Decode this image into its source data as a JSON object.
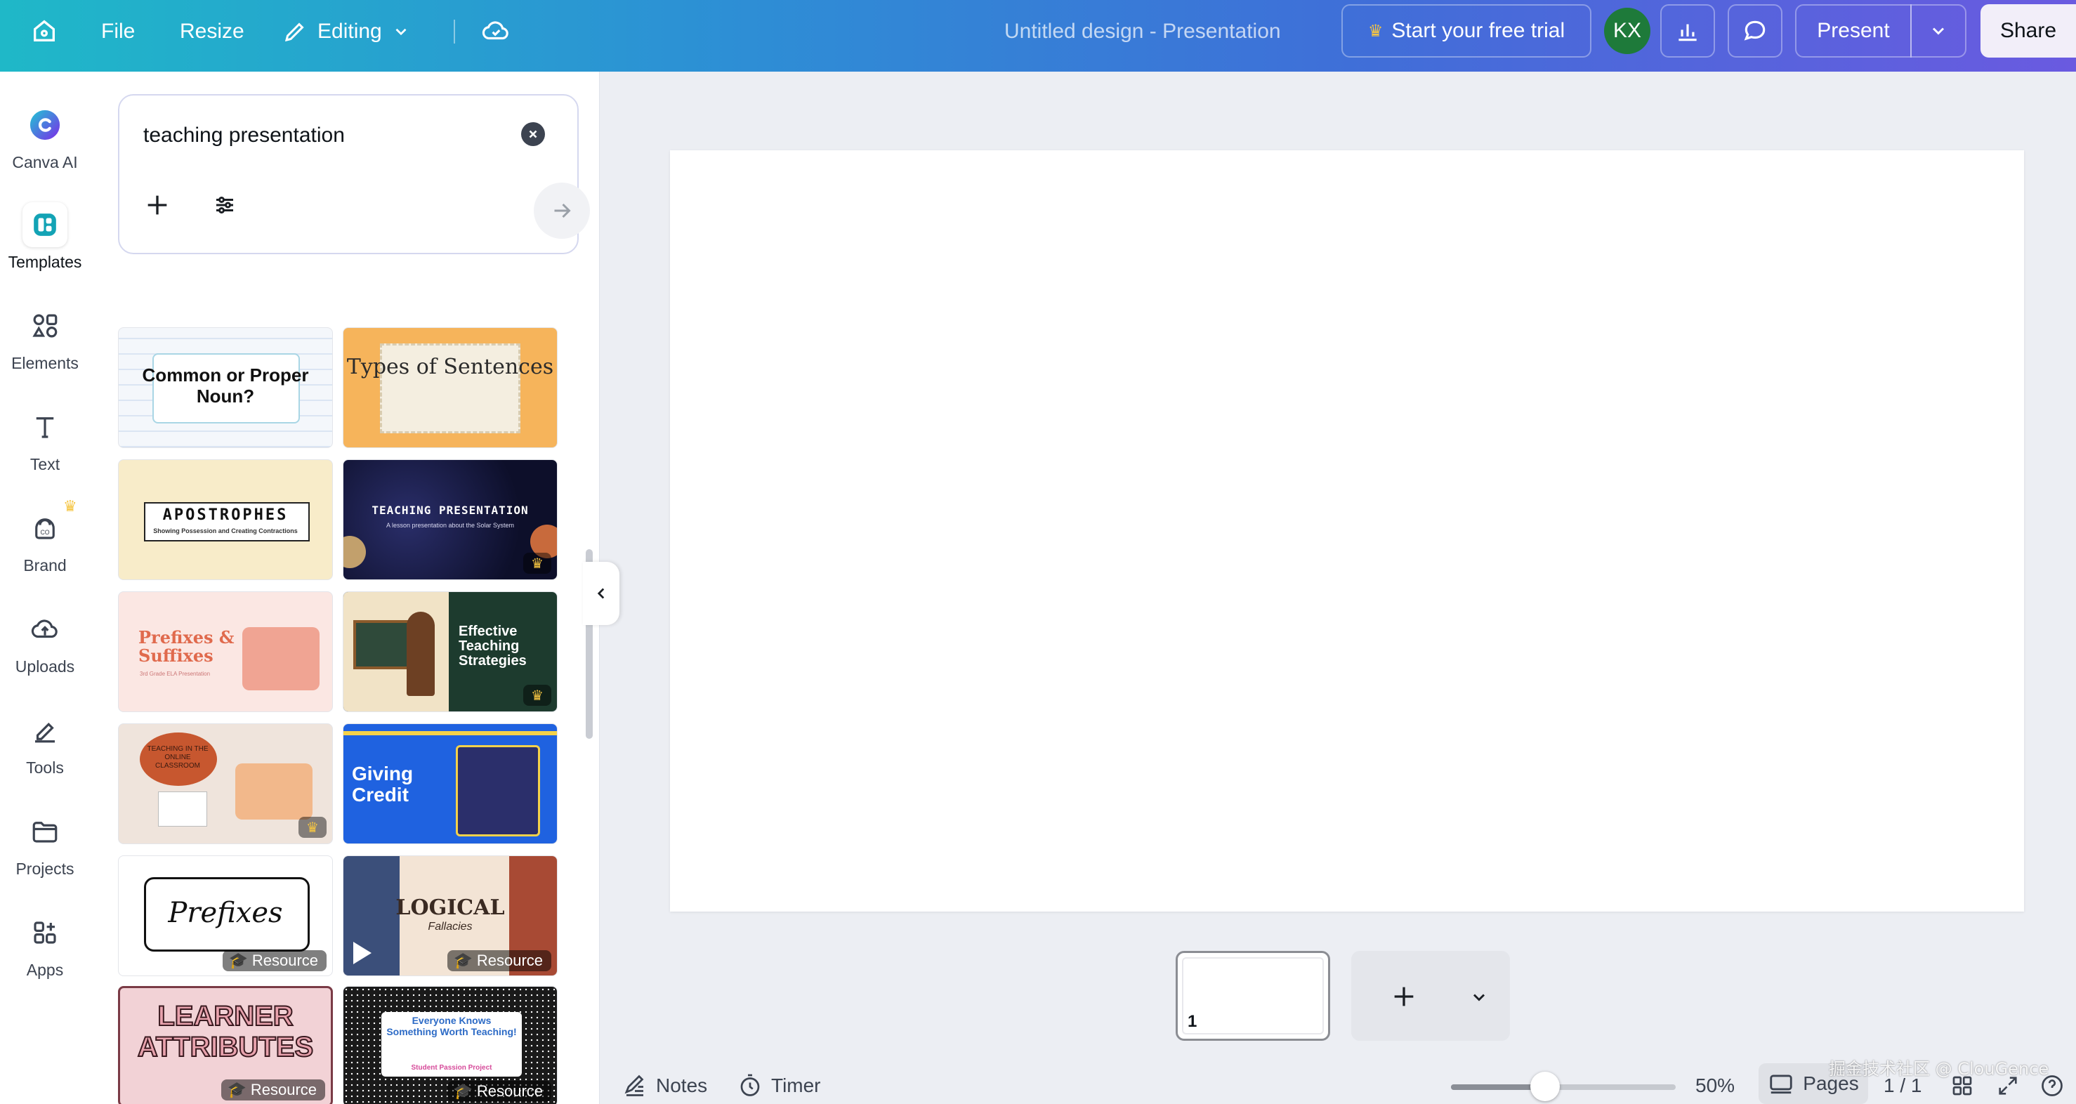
{
  "topbar": {
    "file_label": "File",
    "resize_label": "Resize",
    "editing_label": "Editing",
    "document_title": "Untitled design - Presentation",
    "trial_label": "Start your free trial",
    "avatar_initials": "KX",
    "present_label": "Present",
    "share_label": "Share"
  },
  "sidebar": {
    "items": [
      {
        "label": "Canva AI",
        "icon": "canva-ai-icon"
      },
      {
        "label": "Templates",
        "icon": "templates-icon"
      },
      {
        "label": "Elements",
        "icon": "elements-icon"
      },
      {
        "label": "Text",
        "icon": "text-icon"
      },
      {
        "label": "Brand",
        "icon": "brand-icon"
      },
      {
        "label": "Uploads",
        "icon": "uploads-icon"
      },
      {
        "label": "Tools",
        "icon": "tools-icon"
      },
      {
        "label": "Projects",
        "icon": "projects-icon"
      },
      {
        "label": "Apps",
        "icon": "apps-icon"
      }
    ]
  },
  "search": {
    "value": "teaching presentation"
  },
  "templates": {
    "resource_badge": "Resource",
    "items": [
      {
        "title": "Common or Proper Noun?"
      },
      {
        "title": "Types of Sentences"
      },
      {
        "title": "APOSTROPHES",
        "subtitle": "Showing Possession and Creating Contractions"
      },
      {
        "title": "TEACHING PRESENTATION",
        "subtitle": "A lesson presentation about the Solar System"
      },
      {
        "title": "Prefixes & Suffixes",
        "subtitle": "3rd Grade ELA Presentation"
      },
      {
        "title": "Effective Teaching Strategies"
      },
      {
        "title": "TEACHING IN THE ONLINE CLASSROOM"
      },
      {
        "title": "Giving Credit"
      },
      {
        "title": "Prefixes"
      },
      {
        "title": "LOGICAL",
        "subtitle": "Fallacies"
      },
      {
        "title": "LEARNER ATTRIBUTES"
      },
      {
        "title": "Everyone Knows Something Worth Teaching!",
        "subtitle": "Student Passion Project"
      }
    ]
  },
  "canvas": {
    "page_number": "1"
  },
  "bottombar": {
    "notes_label": "Notes",
    "timer_label": "Timer",
    "zoom_label": "50%",
    "zoom_level": 0.42,
    "pages_label": "Pages",
    "page_count": "1 / 1"
  },
  "watermark": "掘金技术社区 @ ClouGence",
  "colors": {
    "accent": "#7d2ae8",
    "crown": "#f5c542"
  }
}
